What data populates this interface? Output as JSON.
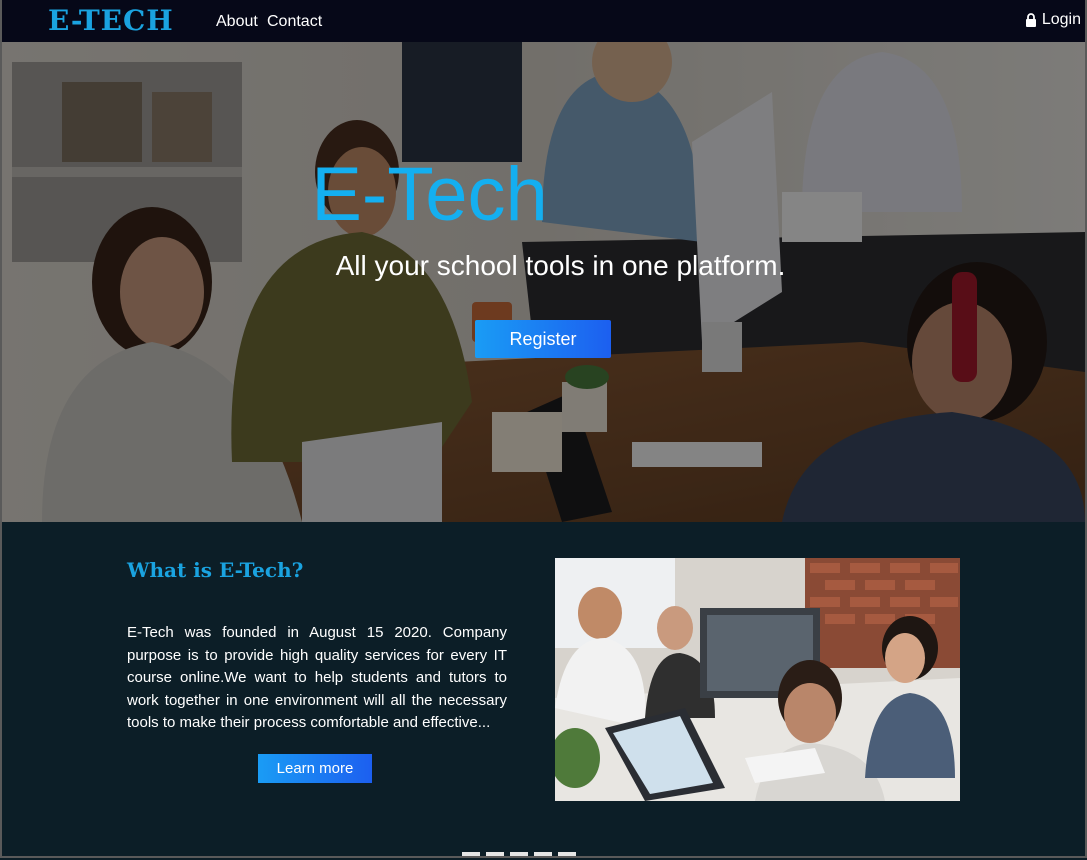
{
  "navbar": {
    "brand": "E-TECH",
    "links": [
      {
        "label": "About"
      },
      {
        "label": "Contact"
      }
    ],
    "login_label": "Login",
    "login_icon": "lock-icon"
  },
  "hero": {
    "title": "E-Tech",
    "subtitle": "All your school tools in one platform.",
    "register_label": "Register"
  },
  "about": {
    "heading": "What is E-Tech?",
    "body": "E-Tech was founded in August 15 2020. Company purpose is to provide high quality services for every IT course online.We want to help students and tutors to work together in one environment will all the necessary tools to make their process comfortable and effective...",
    "learn_more_label": "Learn more"
  },
  "colors": {
    "accent": "#1aa3e0",
    "navbar_bg": "#060818",
    "section_bg": "#0c1e27",
    "button_gradient_start": "#1a9cf5",
    "button_gradient_end": "#1c5ff0"
  }
}
